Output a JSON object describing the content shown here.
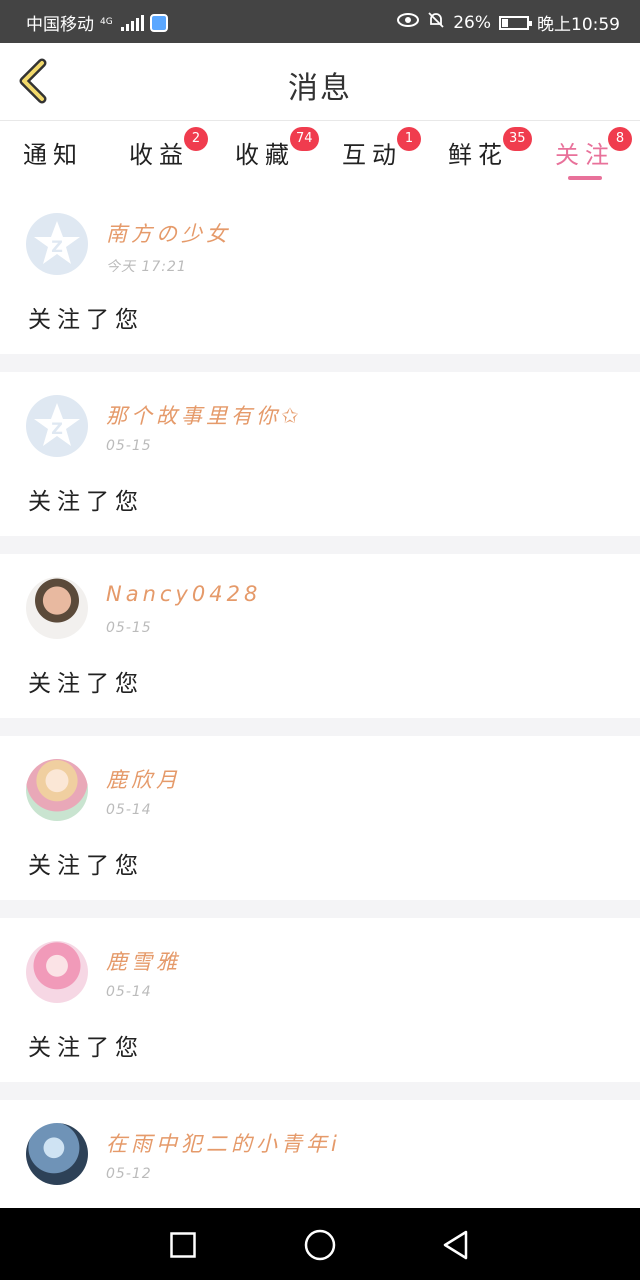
{
  "status_bar": {
    "carrier": "中国移动",
    "network": "4G",
    "battery": "26%",
    "time": "晚上10:59",
    "battery_level": 0.26
  },
  "header": {
    "title": "消息"
  },
  "tabs": [
    {
      "label": "通知",
      "badge": ""
    },
    {
      "label": "收益",
      "badge": "2"
    },
    {
      "label": "收藏",
      "badge": "74"
    },
    {
      "label": "互动",
      "badge": "1"
    },
    {
      "label": "鲜花",
      "badge": "35"
    },
    {
      "label": "关注",
      "badge": "8",
      "active": true
    }
  ],
  "messages": [
    {
      "name": "南方の少女",
      "time": "今天 17:21",
      "action": "关注了您",
      "avatar": "default-avatar-icon"
    },
    {
      "name": "那个故事里有你✩",
      "time": "05-15",
      "action": "关注了您",
      "avatar": "default-avatar-icon"
    },
    {
      "name": "Nancy0428",
      "time": "05-15",
      "action": "关注了您",
      "avatar": "photo"
    },
    {
      "name": "鹿欣月",
      "time": "05-14",
      "action": "关注了您",
      "avatar": "photo"
    },
    {
      "name": "鹿雪雅",
      "time": "05-14",
      "action": "关注了您",
      "avatar": "photo"
    },
    {
      "name": "在雨中犯二的小青年i",
      "time": "05-12",
      "action": "",
      "avatar": "photo"
    }
  ],
  "colors": {
    "accent": "#e8719a",
    "badge": "#f03c4e",
    "username": "#e59a6a",
    "statusbar": "#444444"
  }
}
